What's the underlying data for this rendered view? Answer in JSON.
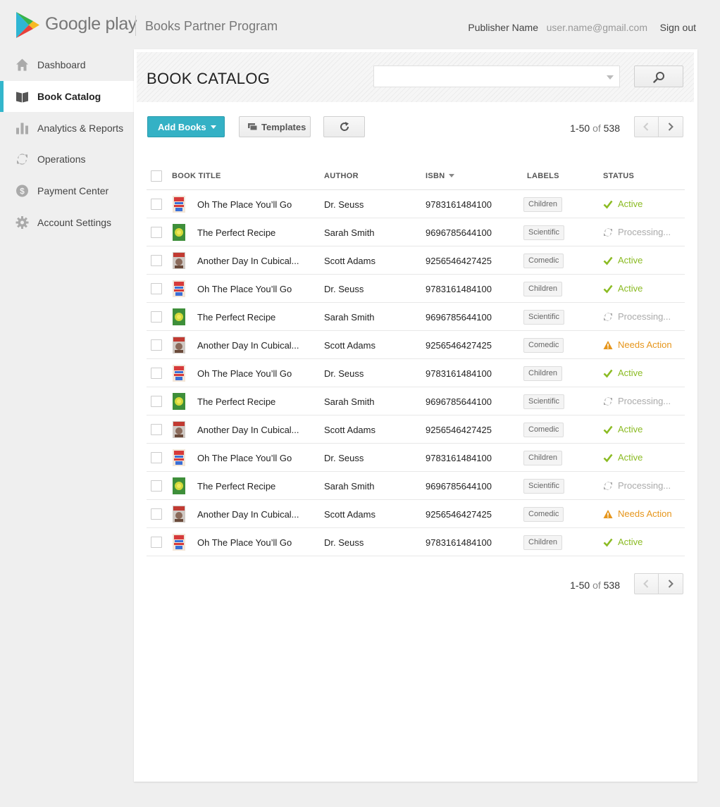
{
  "header": {
    "logo_text": "Google play",
    "program_name": "Books Partner Program",
    "publisher": "Publisher Name",
    "email": "user.name@gmail.com",
    "sign_out": "Sign out"
  },
  "sidebar": {
    "items": [
      {
        "label": "Dashboard",
        "icon": "home-icon",
        "active": false
      },
      {
        "label": "Book Catalog",
        "icon": "book-icon",
        "active": true
      },
      {
        "label": "Analytics & Reports",
        "icon": "bar-chart-icon",
        "active": false
      },
      {
        "label": "Operations",
        "icon": "cycle-icon",
        "active": false
      },
      {
        "label": "Payment Center",
        "icon": "dollar-icon",
        "active": false
      },
      {
        "label": "Account Settings",
        "icon": "gear-icon",
        "active": false
      }
    ]
  },
  "main": {
    "title": "BOOK CATALOG",
    "search_placeholder": "",
    "add_books_label": "Add Books",
    "templates_label": "Templates",
    "pagination": {
      "range": "1-50",
      "of": "of",
      "total": "538"
    }
  },
  "table": {
    "headers": {
      "title": "BOOK TITLE",
      "author": "AUTHOR",
      "isbn": "ISBN",
      "labels": "LABELS",
      "status": "STATUS"
    },
    "rows": [
      {
        "cover": "seuss",
        "title": "Oh The Place You’ll Go",
        "author": "Dr. Seuss",
        "isbn": "9783161484100",
        "label": "Children",
        "status": "Active",
        "status_type": "active"
      },
      {
        "cover": "recipe",
        "title": "The Perfect Recipe",
        "author": "Sarah Smith",
        "isbn": "9696785644100",
        "label": "Scientific",
        "status": "Processing...",
        "status_type": "processing"
      },
      {
        "cover": "dilbert",
        "title": "Another Day In Cubical...",
        "author": "Scott Adams",
        "isbn": "9256546427425",
        "label": "Comedic",
        "status": "Active",
        "status_type": "active"
      },
      {
        "cover": "seuss",
        "title": "Oh The Place You’ll Go",
        "author": "Dr. Seuss",
        "isbn": "9783161484100",
        "label": "Children",
        "status": "Active",
        "status_type": "active"
      },
      {
        "cover": "recipe",
        "title": "The Perfect Recipe",
        "author": "Sarah Smith",
        "isbn": "9696785644100",
        "label": "Scientific",
        "status": "Processing...",
        "status_type": "processing"
      },
      {
        "cover": "dilbert",
        "title": "Another Day In Cubical...",
        "author": "Scott Adams",
        "isbn": "9256546427425",
        "label": "Comedic",
        "status": "Needs Action",
        "status_type": "needs"
      },
      {
        "cover": "seuss",
        "title": "Oh The Place You’ll Go",
        "author": "Dr. Seuss",
        "isbn": "9783161484100",
        "label": "Children",
        "status": "Active",
        "status_type": "active"
      },
      {
        "cover": "recipe",
        "title": "The Perfect Recipe",
        "author": "Sarah Smith",
        "isbn": "9696785644100",
        "label": "Scientific",
        "status": "Processing...",
        "status_type": "processing"
      },
      {
        "cover": "dilbert",
        "title": "Another Day In Cubical...",
        "author": "Scott Adams",
        "isbn": "9256546427425",
        "label": "Comedic",
        "status": "Active",
        "status_type": "active"
      },
      {
        "cover": "seuss",
        "title": "Oh The Place You’ll Go",
        "author": "Dr. Seuss",
        "isbn": "9783161484100",
        "label": "Children",
        "status": "Active",
        "status_type": "active"
      },
      {
        "cover": "recipe",
        "title": "The Perfect Recipe",
        "author": "Sarah Smith",
        "isbn": "9696785644100",
        "label": "Scientific",
        "status": "Processing...",
        "status_type": "processing"
      },
      {
        "cover": "dilbert",
        "title": "Another Day In Cubical...",
        "author": "Scott Adams",
        "isbn": "9256546427425",
        "label": "Comedic",
        "status": "Needs Action",
        "status_type": "needs"
      },
      {
        "cover": "seuss",
        "title": "Oh The Place You’ll Go",
        "author": "Dr. Seuss",
        "isbn": "9783161484100",
        "label": "Children",
        "status": "Active",
        "status_type": "active"
      }
    ]
  },
  "colors": {
    "accent": "#34b1c5",
    "active": "#8bbb23",
    "processing": "#aaaaaa",
    "needs_action": "#e6961c"
  }
}
